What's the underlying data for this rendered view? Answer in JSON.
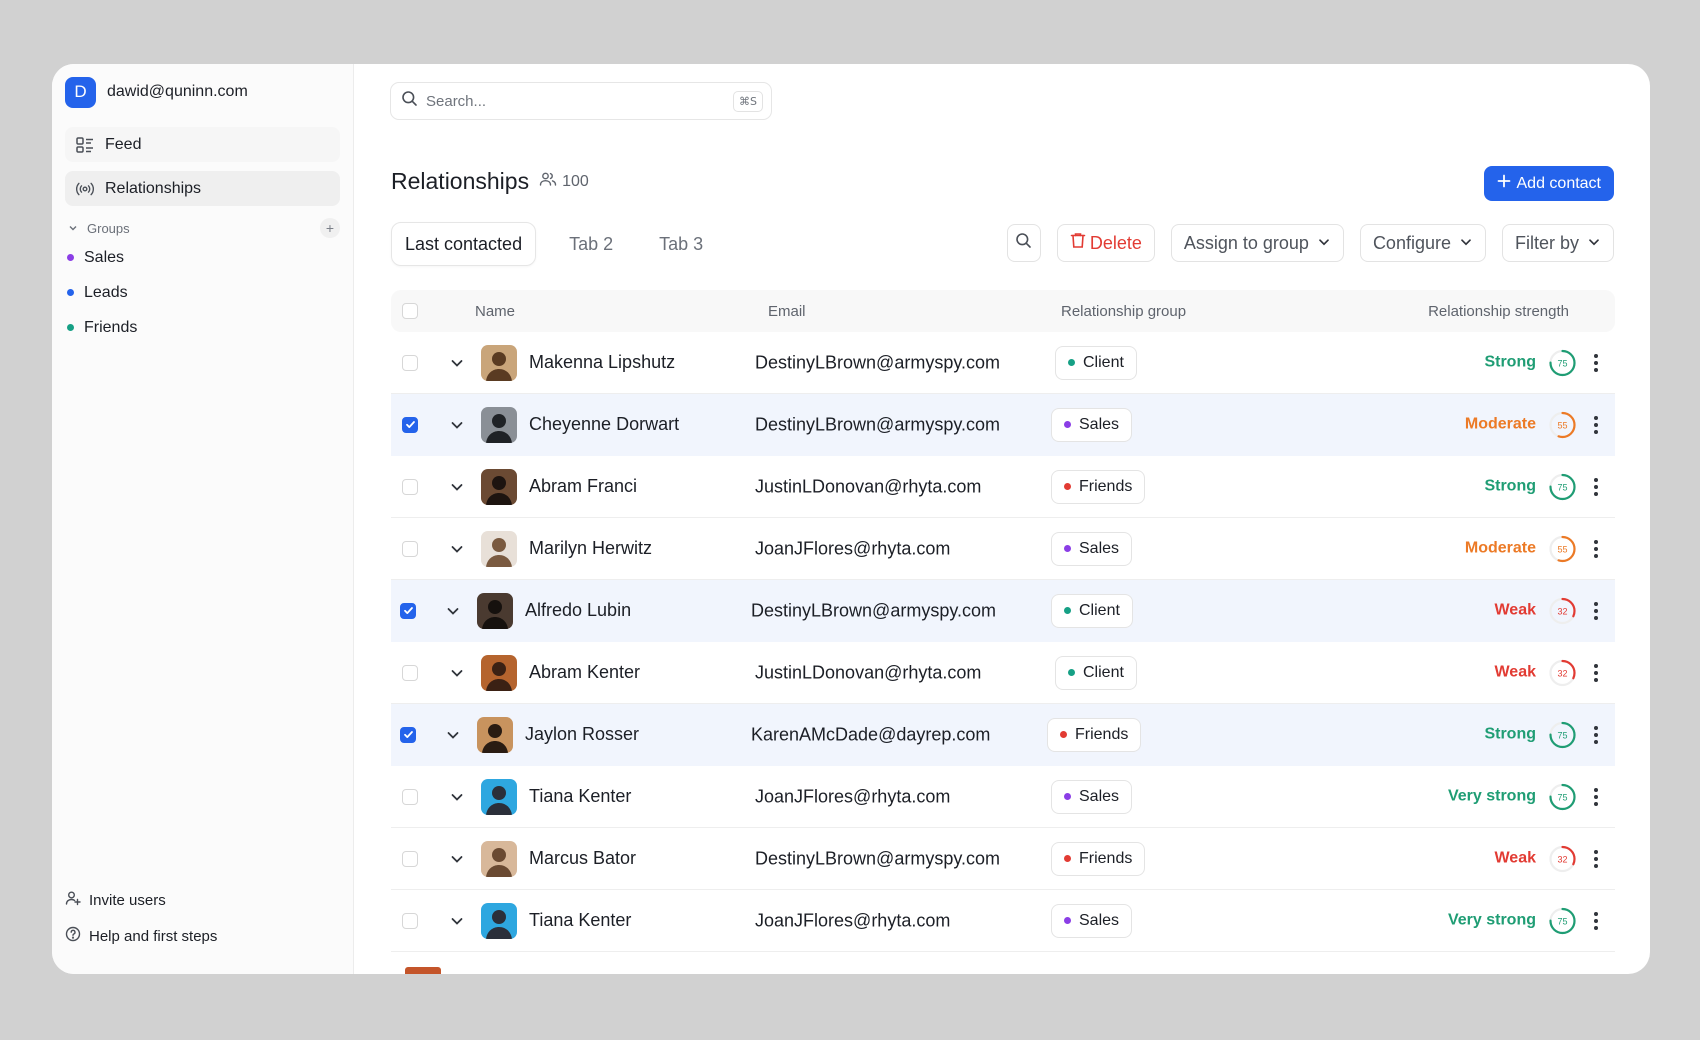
{
  "account": {
    "initial": "D",
    "email": "dawid@quninn.com"
  },
  "nav": [
    {
      "label": "Feed",
      "icon": "feed-icon"
    },
    {
      "label": "Relationships",
      "icon": "broadcast-icon"
    }
  ],
  "groups": {
    "title": "Groups",
    "items": [
      {
        "label": "Sales",
        "color": "#8b3ee6"
      },
      {
        "label": "Leads",
        "color": "#2463eb"
      },
      {
        "label": "Friends",
        "color": "#16a085"
      }
    ]
  },
  "footer": {
    "invite": "Invite users",
    "help": "Help and first steps"
  },
  "search": {
    "placeholder": "Search...",
    "shortcut": "⌘S"
  },
  "page": {
    "title": "Relationships",
    "count": "100",
    "add_button": "Add contact"
  },
  "tabs": [
    "Last contacted",
    "Tab 2",
    "Tab 3"
  ],
  "toolbar": {
    "delete": "Delete",
    "assign": "Assign to group",
    "configure": "Configure",
    "filter": "Filter by"
  },
  "table": {
    "columns": [
      "Name",
      "Email",
      "Relationship group",
      "Relationship strength"
    ],
    "strength_colors": {
      "Strong": "#1f9d74",
      "Very strong": "#1f9d74",
      "Moderate": "#ec7a26",
      "Weak": "#e23b33"
    },
    "group_colors": {
      "Client": "#16a085",
      "Sales": "#8b3ee6",
      "Friends": "#e23b33"
    },
    "rows": [
      {
        "name": "Makenna Lipshutz",
        "email": "DestinyLBrown@armyspy.com",
        "group": "Client",
        "strength": "Strong",
        "score": "75",
        "checked": false
      },
      {
        "name": "Cheyenne Dorwart",
        "email": "DestinyLBrown@armyspy.com",
        "group": "Sales",
        "strength": "Moderate",
        "score": "55",
        "checked": true
      },
      {
        "name": "Abram Franci",
        "email": "JustinLDonovan@rhyta.com",
        "group": "Friends",
        "strength": "Strong",
        "score": "75",
        "checked": false
      },
      {
        "name": "Marilyn Herwitz",
        "email": "JoanJFlores@rhyta.com",
        "group": "Sales",
        "strength": "Moderate",
        "score": "55",
        "checked": false
      },
      {
        "name": "Alfredo Lubin",
        "email": "DestinyLBrown@armyspy.com",
        "group": "Client",
        "strength": "Weak",
        "score": "32",
        "checked": true
      },
      {
        "name": "Abram Kenter",
        "email": "JustinLDonovan@rhyta.com",
        "group": "Client",
        "strength": "Weak",
        "score": "32",
        "checked": false
      },
      {
        "name": "Jaylon Rosser",
        "email": "KarenAMcDade@dayrep.com",
        "group": "Friends",
        "strength": "Strong",
        "score": "75",
        "checked": true
      },
      {
        "name": "Tiana Kenter",
        "email": "JoanJFlores@rhyta.com",
        "group": "Sales",
        "strength": "Very strong",
        "score": "75",
        "checked": false
      },
      {
        "name": "Marcus Bator",
        "email": "DestinyLBrown@armyspy.com",
        "group": "Friends",
        "strength": "Weak",
        "score": "32",
        "checked": false
      },
      {
        "name": "Tiana Kenter",
        "email": "JoanJFlores@rhyta.com",
        "group": "Sales",
        "strength": "Very strong",
        "score": "75",
        "checked": false
      }
    ]
  }
}
